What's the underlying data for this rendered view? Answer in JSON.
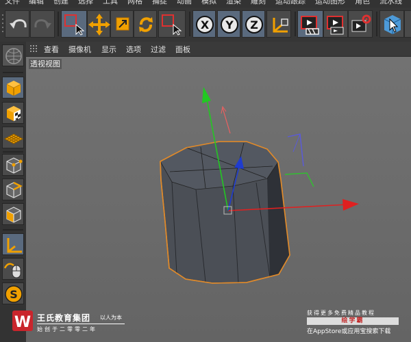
{
  "menu": {
    "items": [
      "文件",
      "编辑",
      "创建",
      "选择",
      "工具",
      "网格",
      "捕捉",
      "动画",
      "模拟",
      "渲染",
      "雕刻",
      "运动跟踪",
      "运动图形",
      "角色",
      "流水线"
    ]
  },
  "toolbar": {
    "buttons": [
      {
        "name": "undo",
        "icon": "undo-icon"
      },
      {
        "name": "redo",
        "icon": "redo-icon"
      },
      {
        "name": "live-select",
        "icon": "selection-arrow-icon"
      },
      {
        "name": "move",
        "icon": "move-icon"
      },
      {
        "name": "scale",
        "icon": "scale-icon"
      },
      {
        "name": "rotate",
        "icon": "rotate-icon"
      },
      {
        "name": "last-tool",
        "icon": "selection-arrow-icon"
      },
      {
        "name": "x-axis",
        "label": "X"
      },
      {
        "name": "y-axis",
        "label": "Y"
      },
      {
        "name": "z-axis",
        "label": "Z"
      },
      {
        "name": "coordinate-system",
        "icon": "axes-icon"
      },
      {
        "name": "render-view",
        "icon": "clapper-icon"
      },
      {
        "name": "render-to-picture-viewer",
        "icon": "clapper-icon"
      },
      {
        "name": "render-settings",
        "icon": "clapper-gear-icon"
      },
      {
        "name": "cube-primitive",
        "icon": "cube-icon"
      },
      {
        "name": "more",
        "icon": "cursor-icon"
      }
    ]
  },
  "view_menu": {
    "items": [
      "查看",
      "摄像机",
      "显示",
      "选项",
      "过滤",
      "面板"
    ]
  },
  "viewport": {
    "label": "透视视图",
    "object": "cylinder",
    "selection_color": "#e08a2a",
    "axis_colors": {
      "x": "#e02020",
      "y": "#22c822",
      "z": "#1f3ccf"
    }
  },
  "left_palette": {
    "items": [
      "make-editable-icon",
      "model-mode-icon",
      "texture-mode-icon",
      "workplane-mode-icon",
      "points-mode-icon",
      "edges-mode-icon",
      "polygons-mode-icon",
      "axis-mode-icon",
      "tweak-mode-icon",
      "snap-icon"
    ]
  },
  "watermark_left": {
    "logo": "W",
    "brand": "王氏教育集团",
    "motto": "以人为本",
    "sub": "始创于二零零二年"
  },
  "watermark_right": {
    "line1": "获得更多免费精品教程",
    "line2": "绘学霸",
    "line3": "在AppStore或应用宝搜索下载"
  }
}
